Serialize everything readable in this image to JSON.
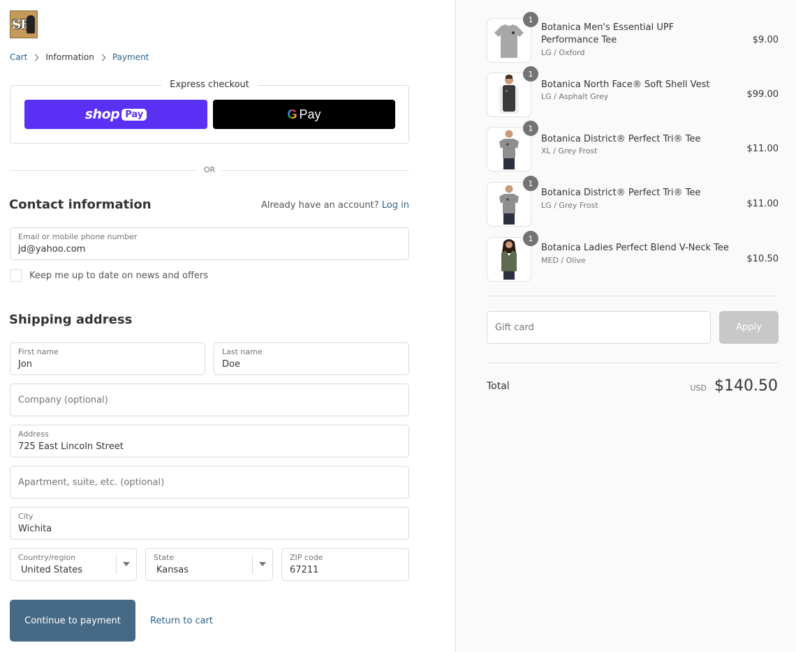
{
  "breadcrumb": {
    "cart": "Cart",
    "information": "Information",
    "payment": "Payment"
  },
  "express": {
    "title": "Express checkout",
    "shop_word": "shop",
    "shop_pill": "Pay",
    "gpay_g": "G",
    "gpay_text": "Pay"
  },
  "or_text": "OR",
  "contact": {
    "title": "Contact information",
    "have_account": "Already have an account?",
    "login": "Log in",
    "email_label": "Email or mobile phone number",
    "email_value": "jd@yahoo.com",
    "newsletter": "Keep me up to date on news and offers"
  },
  "shipping": {
    "title": "Shipping address",
    "first_name_label": "First name",
    "first_name": "Jon",
    "last_name_label": "Last name",
    "last_name": "Doe",
    "company_placeholder": "Company (optional)",
    "address_label": "Address",
    "address": "725 East Lincoln Street",
    "apartment_placeholder": "Apartment, suite, etc. (optional)",
    "city_label": "City",
    "city": "Wichita",
    "country_label": "Country/region",
    "country": "United States",
    "state_label": "State",
    "state": "Kansas",
    "zip_label": "ZIP code",
    "zip": "67211"
  },
  "actions": {
    "continue": "Continue to payment",
    "return": "Return to cart"
  },
  "items": [
    {
      "name": "Botanica Men's Essential UPF Performance Tee",
      "variant": "LG / Oxford",
      "price": "$9.00",
      "qty": "1"
    },
    {
      "name": "Botanica North Face® Soft Shell Vest",
      "variant": "LG / Asphalt Grey",
      "price": "$99.00",
      "qty": "1"
    },
    {
      "name": "Botanica District® Perfect Tri® Tee",
      "variant": "XL / Grey Frost",
      "price": "$11.00",
      "qty": "1"
    },
    {
      "name": "Botanica District® Perfect Tri® Tee",
      "variant": "LG / Grey Frost",
      "price": "$11.00",
      "qty": "1"
    },
    {
      "name": "Botanica Ladies Perfect Blend V-Neck Tee",
      "variant": "MED / Olive",
      "price": "$10.50",
      "qty": "1"
    }
  ],
  "gift": {
    "placeholder": "Gift card",
    "apply": "Apply"
  },
  "summary": {
    "total_label": "Total",
    "currency": "USD",
    "total": "$140.50"
  },
  "colors": {
    "shop_pay": "#5a31f4",
    "primary_button": "#466a86",
    "link": "#2a5f8a"
  }
}
